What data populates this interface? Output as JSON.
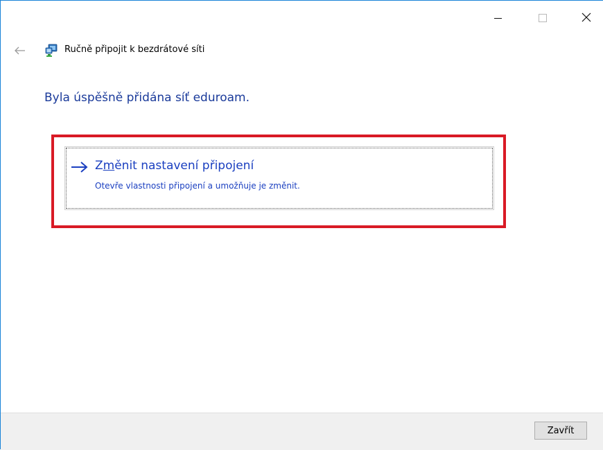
{
  "window": {
    "controls": {
      "minimize_icon": "minimize-icon",
      "maximize_icon": "maximize-icon",
      "close_icon": "close-icon"
    }
  },
  "nav": {
    "back_icon": "back-arrow-icon",
    "app_icon": "network-icon",
    "title": "Ručně připojit k bezdrátové síti"
  },
  "main": {
    "heading": "Byla úspěšně přidána síť eduroam.",
    "command_link": {
      "icon": "arrow-right-icon",
      "title_prefix": "Z",
      "title_accel": "m",
      "title_rest": "ěnit nastavení připojení",
      "description": "Otevře vlastnosti připojení a umožňuje je změnit."
    },
    "highlight_color": "#d91a25"
  },
  "footer": {
    "close_label": "Zavřít"
  },
  "colors": {
    "heading": "#1a3a9a",
    "link": "#1a3fc0",
    "footer_bg": "#f0f0f0",
    "window_border": "#1883d7"
  }
}
